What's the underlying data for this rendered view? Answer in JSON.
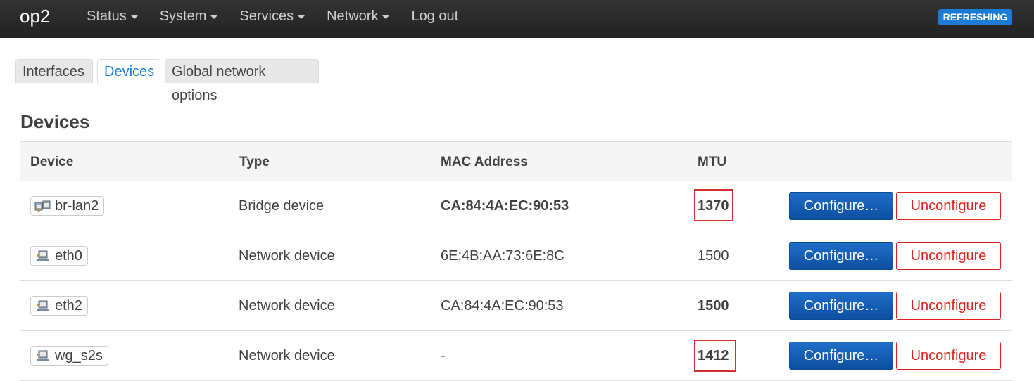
{
  "header": {
    "brand": "op2",
    "menu": [
      {
        "label": "Status",
        "dropdown": true
      },
      {
        "label": "System",
        "dropdown": true
      },
      {
        "label": "Services",
        "dropdown": true
      },
      {
        "label": "Network",
        "dropdown": true
      },
      {
        "label": "Log out",
        "dropdown": false
      }
    ],
    "status_badge": "REFRESHING"
  },
  "tabs": [
    {
      "label": "Interfaces",
      "active": false
    },
    {
      "label": "Devices",
      "active": true
    },
    {
      "label": "Global network options",
      "active": false
    }
  ],
  "section_title": "Devices",
  "table": {
    "headers": {
      "device": "Device",
      "type": "Type",
      "mac": "MAC Address",
      "mtu": "MTU"
    },
    "rows": [
      {
        "device": "br-lan2",
        "icon": "bridge-icon",
        "type": "Bridge device",
        "mac": "CA:84:4A:EC:90:53",
        "mac_bold": true,
        "mtu": "1370",
        "mtu_bold": true,
        "mtu_highlighted": true
      },
      {
        "device": "eth0",
        "icon": "ethernet-icon",
        "type": "Network device",
        "mac": "6E:4B:AA:73:6E:8C",
        "mac_bold": false,
        "mtu": "1500",
        "mtu_bold": false,
        "mtu_highlighted": false
      },
      {
        "device": "eth2",
        "icon": "ethernet-icon",
        "type": "Network device",
        "mac": "CA:84:4A:EC:90:53",
        "mac_bold": false,
        "mtu": "1500",
        "mtu_bold": true,
        "mtu_highlighted": false
      },
      {
        "device": "wg_s2s",
        "icon": "ethernet-icon",
        "type": "Network device",
        "mac": "-",
        "mac_bold": false,
        "mtu": "1412",
        "mtu_bold": true,
        "mtu_highlighted": true
      }
    ],
    "configure_label": "Configure…",
    "unconfigure_label": "Unconfigure"
  },
  "colors": {
    "accent": "#1c7cd5",
    "navbar": "#2b2b2b",
    "danger": "#e0231c",
    "highlight": "#d32f2f"
  }
}
